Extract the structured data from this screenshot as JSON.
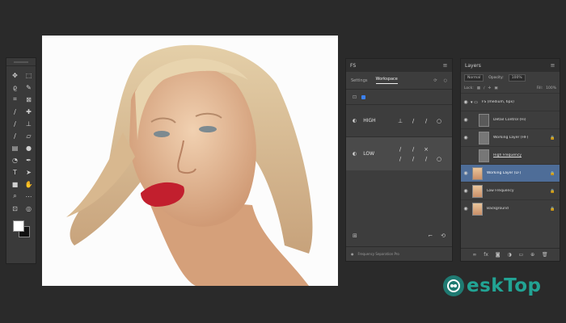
{
  "toolbar": {
    "tools": [
      "move",
      "marquee",
      "lasso",
      "quick-select",
      "crop",
      "frame",
      "eyedropper",
      "healing",
      "brush",
      "clone-stamp",
      "history-brush",
      "eraser",
      "gradient",
      "blur",
      "dodge",
      "pen",
      "type",
      "path-select",
      "rectangle",
      "hand",
      "zoom",
      "more",
      "edit-toolbar",
      "quick-mask"
    ]
  },
  "fs_panel": {
    "title": "FS",
    "tabs": [
      "Settings",
      "Workspace"
    ],
    "row_high_label": "HIGH",
    "row_low_label": "LOW",
    "footer_text": "Frequency Separation Pro"
  },
  "layers_panel": {
    "title": "Layers",
    "blend_mode": "Normal",
    "opacity_label": "Opacity:",
    "opacity_value": "100%",
    "lock_label": "Lock:",
    "fill_label": "Fill:",
    "fill_value": "100%",
    "items": [
      {
        "name": "FS (medium, 6px)",
        "type": "group"
      },
      {
        "name": "Detail Control (Hi)",
        "type": "adjust"
      },
      {
        "name": "Working Layer (HF)",
        "type": "layer"
      },
      {
        "name": "High Frequency",
        "type": "layer"
      },
      {
        "name": "Working Layer (LF)",
        "type": "layer",
        "selected": true
      },
      {
        "name": "Low Frequency",
        "type": "layer"
      },
      {
        "name": "Background",
        "type": "layer"
      }
    ]
  },
  "watermark": {
    "text": "eskTop"
  },
  "colors": {
    "accent": "#4e6d98",
    "brand": "#22a394"
  }
}
